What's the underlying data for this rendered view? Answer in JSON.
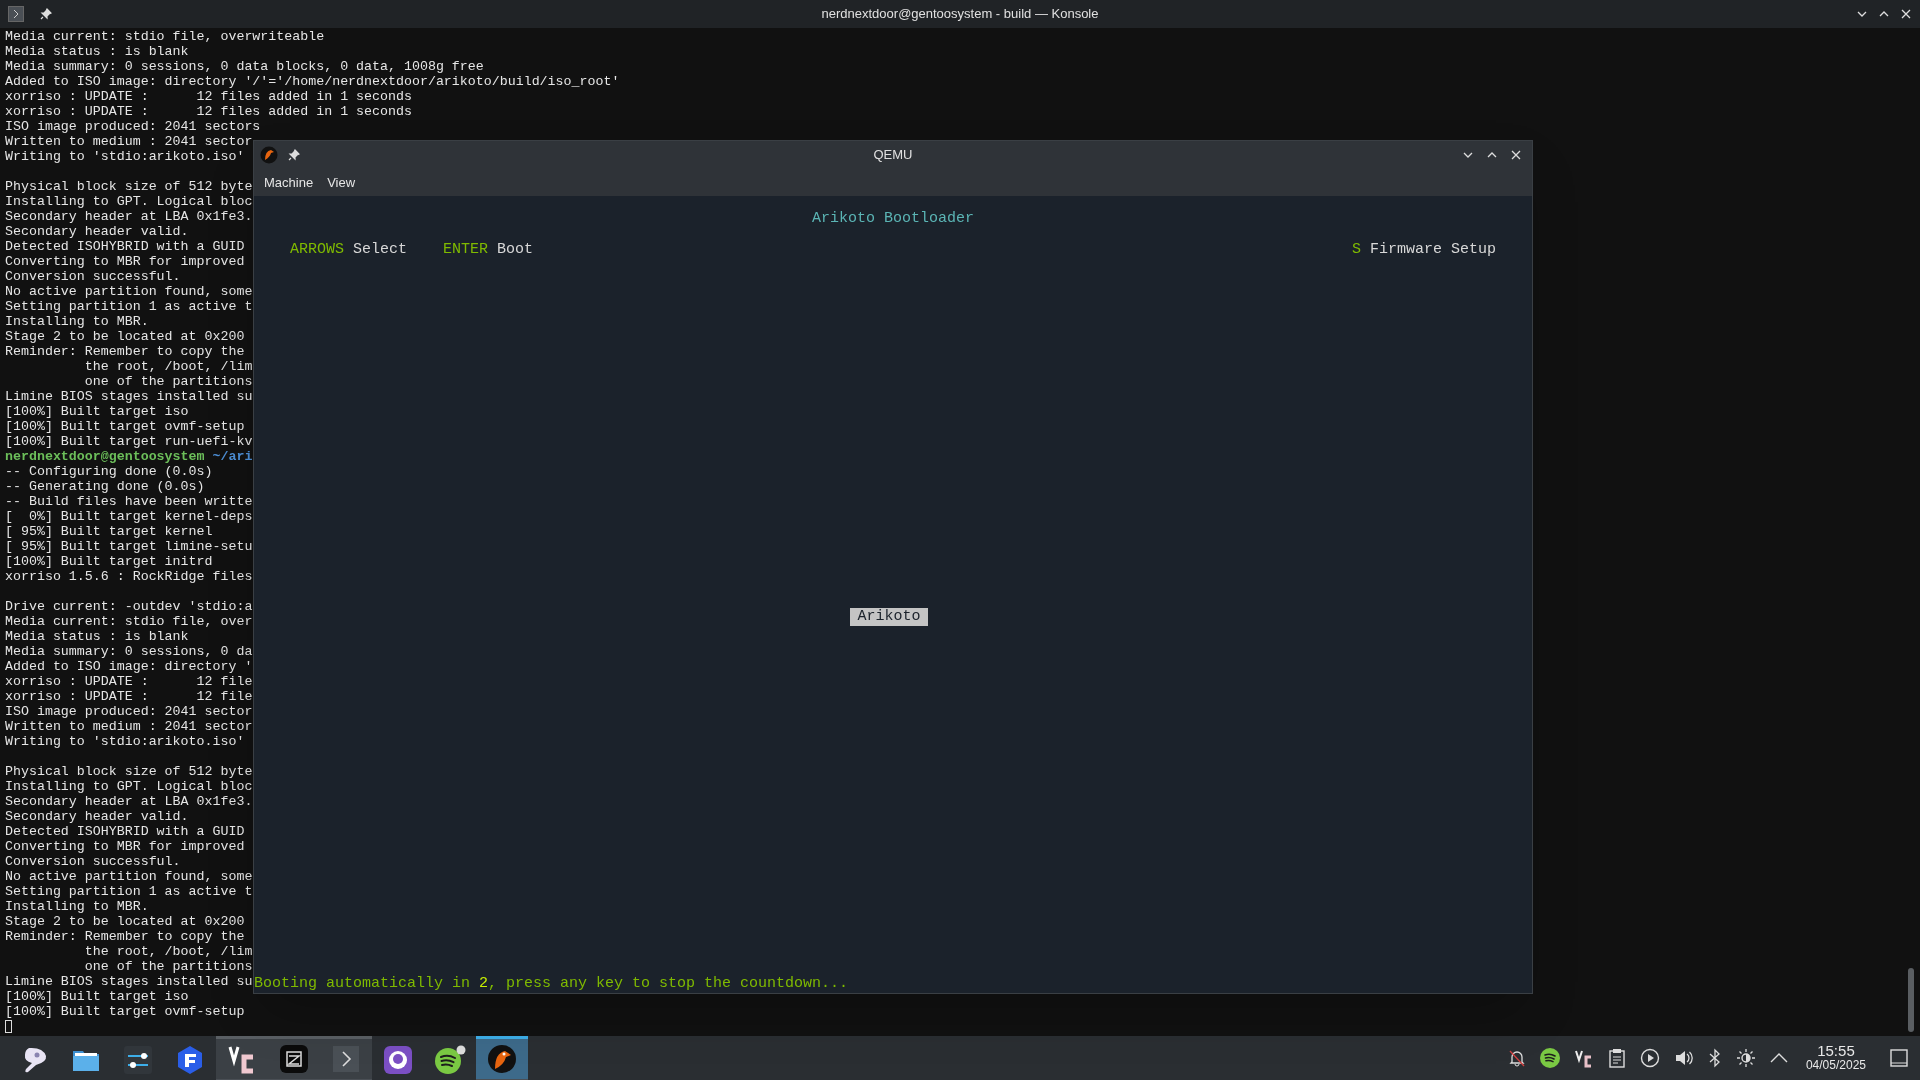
{
  "konsole": {
    "title": "nerdnextdoor@gentoosystem - build — Konsole",
    "lines": [
      {
        "kind": "output",
        "text": "Media current: stdio file, overwriteable"
      },
      {
        "kind": "output",
        "text": "Media status : is blank"
      },
      {
        "kind": "output",
        "text": "Media summary: 0 sessions, 0 data blocks, 0 data, 1008g free"
      },
      {
        "kind": "output",
        "text": "Added to ISO image: directory '/'='/home/nerdnextdoor/arikoto/build/iso_root'"
      },
      {
        "kind": "output",
        "text": "xorriso : UPDATE :      12 files added in 1 seconds"
      },
      {
        "kind": "output",
        "text": "xorriso : UPDATE :      12 files added in 1 seconds"
      },
      {
        "kind": "output",
        "text": "ISO image produced: 2041 sectors"
      },
      {
        "kind": "output",
        "text": "Written to medium : 2041 sector"
      },
      {
        "kind": "output",
        "text": "Writing to 'stdio:arikoto.iso'"
      },
      {
        "kind": "blank"
      },
      {
        "kind": "output",
        "text": "Physical block size of 512 byte"
      },
      {
        "kind": "output",
        "text": "Installing to GPT. Logical bloc"
      },
      {
        "kind": "output",
        "text": "Secondary header at LBA 0x1fe3."
      },
      {
        "kind": "output",
        "text": "Secondary header valid."
      },
      {
        "kind": "output",
        "text": "Detected ISOHYBRID with a GUID"
      },
      {
        "kind": "output",
        "text": "Converting to MBR for improved"
      },
      {
        "kind": "output",
        "text": "Conversion successful."
      },
      {
        "kind": "output",
        "text": "No active partition found, some"
      },
      {
        "kind": "output",
        "text": "Setting partition 1 as active t"
      },
      {
        "kind": "output",
        "text": "Installing to MBR."
      },
      {
        "kind": "output",
        "text": "Stage 2 to be located at 0x200"
      },
      {
        "kind": "output",
        "text": "Reminder: Remember to copy the"
      },
      {
        "kind": "output",
        "text": "          the root, /boot, /lim"
      },
      {
        "kind": "output",
        "text": "          one of the partitions"
      },
      {
        "kind": "output",
        "text": "Limine BIOS stages installed su"
      },
      {
        "kind": "output",
        "text": "[100%] Built target iso"
      },
      {
        "kind": "output",
        "text": "[100%] Built target ovmf-setup"
      },
      {
        "kind": "output",
        "text": "[100%] Built target run-uefi-kv"
      },
      {
        "kind": "prompt",
        "user": "nerdnextdoor@gentoosystem",
        "path": "~/ari"
      },
      {
        "kind": "output",
        "text": "-- Configuring done (0.0s)"
      },
      {
        "kind": "output",
        "text": "-- Generating done (0.0s)"
      },
      {
        "kind": "output",
        "text": "-- Build files have been writte"
      },
      {
        "kind": "output",
        "text": "[  0%] Built target kernel-deps"
      },
      {
        "kind": "output",
        "text": "[ 95%] Built target kernel"
      },
      {
        "kind": "output",
        "text": "[ 95%] Built target limine-setu"
      },
      {
        "kind": "output",
        "text": "[100%] Built target initrd"
      },
      {
        "kind": "output",
        "text": "xorriso 1.5.6 : RockRidge files"
      },
      {
        "kind": "blank"
      },
      {
        "kind": "output",
        "text": "Drive current: -outdev 'stdio:a"
      },
      {
        "kind": "output",
        "text": "Media current: stdio file, over"
      },
      {
        "kind": "output",
        "text": "Media status : is blank"
      },
      {
        "kind": "output",
        "text": "Media summary: 0 sessions, 0 da"
      },
      {
        "kind": "output",
        "text": "Added to ISO image: directory '"
      },
      {
        "kind": "output",
        "text": "xorriso : UPDATE :      12 file"
      },
      {
        "kind": "output",
        "text": "xorriso : UPDATE :      12 file"
      },
      {
        "kind": "output",
        "text": "ISO image produced: 2041 sector"
      },
      {
        "kind": "output",
        "text": "Written to medium : 2041 sector"
      },
      {
        "kind": "output",
        "text": "Writing to 'stdio:arikoto.iso'"
      },
      {
        "kind": "blank"
      },
      {
        "kind": "output",
        "text": "Physical block size of 512 byte"
      },
      {
        "kind": "output",
        "text": "Installing to GPT. Logical bloc"
      },
      {
        "kind": "output",
        "text": "Secondary header at LBA 0x1fe3."
      },
      {
        "kind": "output",
        "text": "Secondary header valid."
      },
      {
        "kind": "output",
        "text": "Detected ISOHYBRID with a GUID"
      },
      {
        "kind": "output",
        "text": "Converting to MBR for improved"
      },
      {
        "kind": "output",
        "text": "Conversion successful."
      },
      {
        "kind": "output",
        "text": "No active partition found, some"
      },
      {
        "kind": "output",
        "text": "Setting partition 1 as active t"
      },
      {
        "kind": "output",
        "text": "Installing to MBR."
      },
      {
        "kind": "output",
        "text": "Stage 2 to be located at 0x200"
      },
      {
        "kind": "output",
        "text": "Reminder: Remember to copy the"
      },
      {
        "kind": "output",
        "text": "          the root, /boot, /lim"
      },
      {
        "kind": "output",
        "text": "          one of the partitions"
      },
      {
        "kind": "output",
        "text": "Limine BIOS stages installed su"
      },
      {
        "kind": "output",
        "text": "[100%] Built target iso"
      },
      {
        "kind": "output",
        "text": "[100%] Built target ovmf-setup"
      },
      {
        "kind": "cursor"
      }
    ]
  },
  "qemu": {
    "title": "QEMU",
    "menu": [
      "Machine",
      "View"
    ],
    "guest": {
      "title": "Arikoto Bootloader",
      "hints": [
        {
          "key": "ARROWS",
          "action": "Select"
        },
        {
          "key": "ENTER",
          "action": "Boot"
        }
      ],
      "right_hint": {
        "key": "S",
        "action": "Firmware Setup"
      },
      "entries": [
        {
          "label": "Arikoto",
          "selected": true
        }
      ],
      "countdown": {
        "before": "Booting automatically in ",
        "seconds": "2",
        "after": ", press any key to stop the countdown..."
      }
    }
  },
  "taskbar": {
    "apps": [
      {
        "running": false,
        "active": false
      },
      {
        "running": false,
        "active": false
      },
      {
        "running": false,
        "active": false
      },
      {
        "running": false,
        "active": false
      },
      {
        "running": true,
        "active": false
      },
      {
        "running": true,
        "active": false
      },
      {
        "running": true,
        "active": false
      },
      {
        "running": false,
        "active": false
      },
      {
        "running": false,
        "active": false
      },
      {
        "running": true,
        "active": true
      }
    ],
    "clock": {
      "time": "15:55",
      "date": "04/05/2025"
    }
  }
}
